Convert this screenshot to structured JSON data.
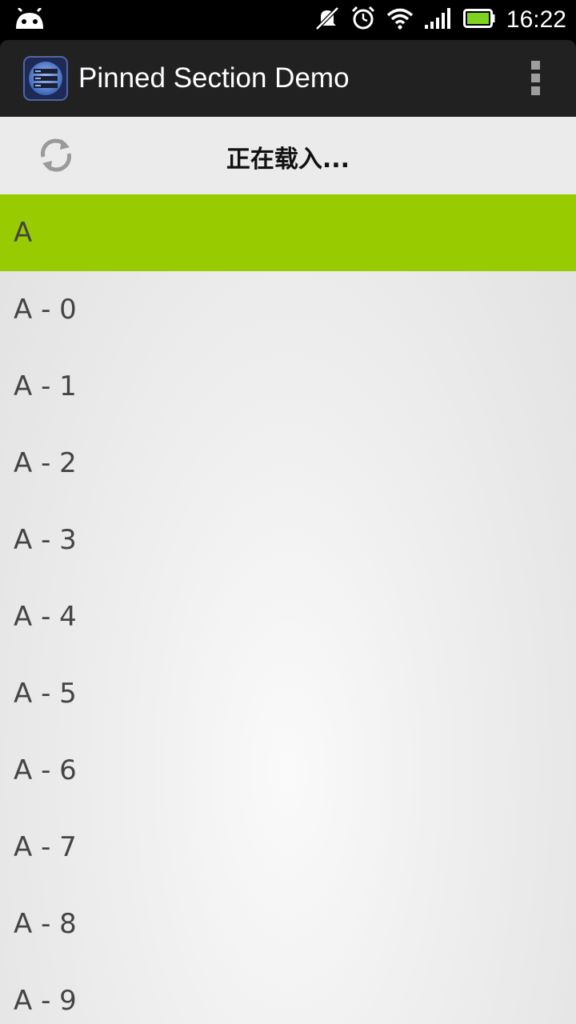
{
  "status_bar": {
    "time": "16:22",
    "icons": [
      "android-icon",
      "mute-icon",
      "alarm-icon",
      "wifi-icon",
      "signal-icon",
      "battery-icon"
    ],
    "battery_color": "#7ed321"
  },
  "action_bar": {
    "title": "Pinned Section Demo",
    "icon": "list-app-icon",
    "menu_icon": "overflow-menu-icon"
  },
  "loading": {
    "text": "正在载入...",
    "icon": "refresh-icon"
  },
  "section": {
    "label": "A",
    "color": "#99cc00"
  },
  "items": [
    {
      "label": "A - 0"
    },
    {
      "label": "A - 1"
    },
    {
      "label": "A - 2"
    },
    {
      "label": "A - 3"
    },
    {
      "label": "A - 4"
    },
    {
      "label": "A - 5"
    },
    {
      "label": "A - 6"
    },
    {
      "label": "A - 7"
    },
    {
      "label": "A - 8"
    },
    {
      "label": "A - 9"
    }
  ]
}
